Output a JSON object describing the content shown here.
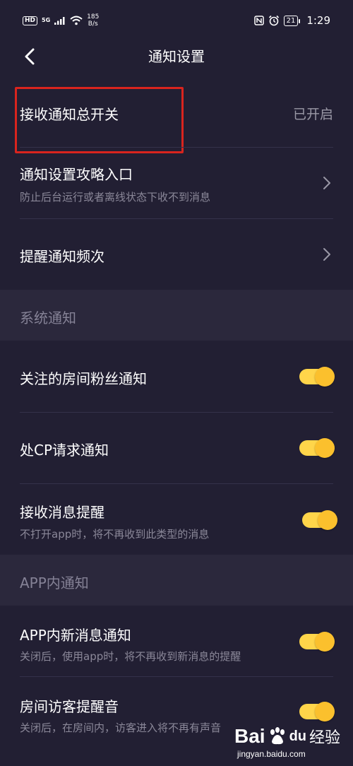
{
  "status_bar": {
    "hd_label": "HD",
    "network_label": "5G",
    "speed_value": "185",
    "speed_unit": "B/s",
    "battery_level": "21",
    "time": "1:29"
  },
  "nav": {
    "title": "通知设置"
  },
  "settings": {
    "master": {
      "title": "接收通知总开关",
      "value": "已开启"
    },
    "guide": {
      "title": "通知设置攻略入口",
      "subtitle": "防止后台运行或者离线状态下收不到消息"
    },
    "frequency": {
      "title": "提醒通知频次"
    }
  },
  "sections": {
    "system": {
      "label": "系统通知",
      "items": [
        {
          "title": "关注的房间粉丝通知",
          "on": true
        },
        {
          "title": "处CP请求通知",
          "on": true
        },
        {
          "title": "接收消息提醒",
          "subtitle": "不打开app时，将不再收到此类型的消息",
          "on": true
        }
      ]
    },
    "in_app": {
      "label": "APP内通知",
      "items": [
        {
          "title": "APP内新消息通知",
          "subtitle": "关闭后，使用app时，将不再收到新消息的提醒",
          "on": true
        },
        {
          "title": "房间访客提醒音",
          "subtitle": "关闭后，在房间内，访客进入将不再有声音",
          "on": true
        }
      ]
    }
  },
  "watermark": {
    "brand_a": "Bai",
    "brand_b": "du",
    "brand_cn": "经验",
    "url": "jingyan.baidu.com"
  },
  "colors": {
    "background": "#221f33",
    "section_bg": "#2b283c",
    "toggle_track": "#ffd54a",
    "toggle_knob": "#fbc02d",
    "highlight": "#d9241e"
  }
}
